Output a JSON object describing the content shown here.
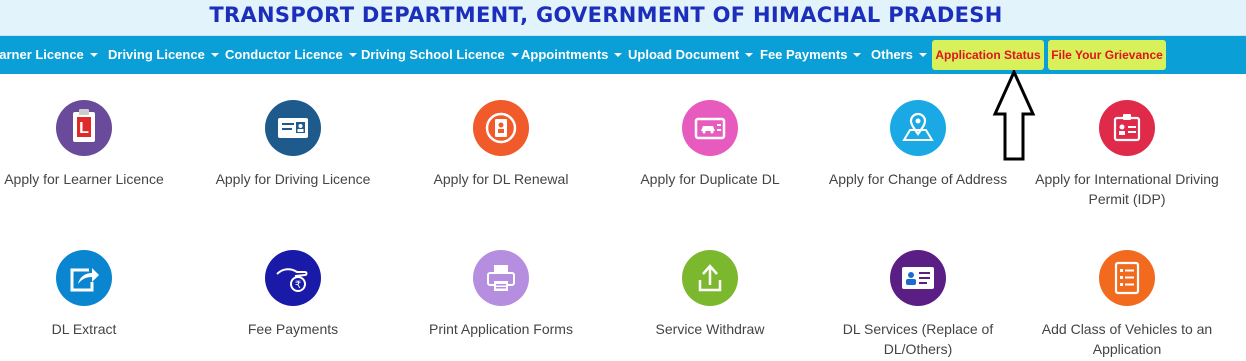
{
  "header": {
    "title": "TRANSPORT DEPARTMENT, GOVERNMENT OF HIMACHAL PRADESH"
  },
  "nav": {
    "items": [
      "earner Licence",
      "Driving Licence",
      "Conductor Licence",
      "Driving School Licence",
      "Appointments",
      "Upload Document",
      "Fee Payments",
      "Others"
    ],
    "application_status": "Application Status",
    "grievance": "File Your Grievance"
  },
  "services": {
    "row1": [
      {
        "label": "Apply for Learner Licence",
        "icon": "learner-licence-icon",
        "color": "#6a4a9a"
      },
      {
        "label": "Apply for Driving Licence",
        "icon": "driving-licence-icon",
        "color": "#1e5a8c"
      },
      {
        "label": "Apply for DL Renewal",
        "icon": "dl-renewal-icon",
        "color": "#f15a2a"
      },
      {
        "label": "Apply for Duplicate DL",
        "icon": "duplicate-dl-icon",
        "color": "#e75bbf"
      },
      {
        "label": "Apply for Change of Address",
        "icon": "map-pin-icon",
        "color": "#1aa9e4"
      },
      {
        "label": "Apply for International Driving Permit (IDP)",
        "icon": "id-card-icon",
        "color": "#e02a4a"
      }
    ],
    "row2": [
      {
        "label": "DL Extract",
        "icon": "share-arrow-icon",
        "color": "#0a86d0"
      },
      {
        "label": "Fee Payments",
        "icon": "rupee-hand-icon",
        "color": "#1a1aa8"
      },
      {
        "label": "Print Application Forms",
        "icon": "printer-icon",
        "color": "#b58ee0"
      },
      {
        "label": "Service Withdraw",
        "icon": "upload-tray-icon",
        "color": "#7cb82e"
      },
      {
        "label": "DL Services (Replace of DL/Others)",
        "icon": "contact-card-icon",
        "color": "#5a1e84"
      },
      {
        "label": "Add Class of Vehicles to an Application",
        "icon": "checklist-icon",
        "color": "#f26a1e"
      }
    ]
  }
}
